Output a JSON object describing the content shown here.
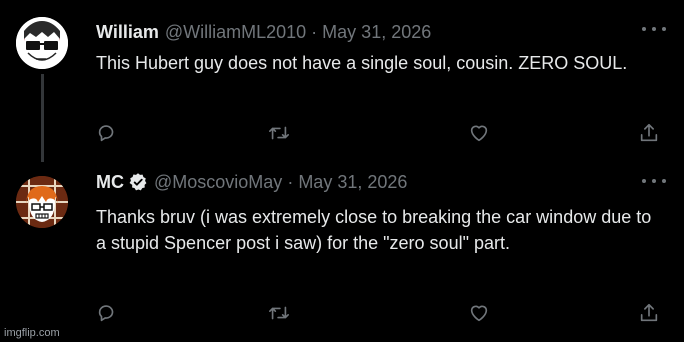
{
  "tweets": [
    {
      "name": "William",
      "handle": "@WilliamML2010",
      "separator": "·",
      "date": "May 31, 2026",
      "text": "This Hubert guy does not have a single soul, cousin. ZERO SOUL.",
      "verified": false
    },
    {
      "name": "MC",
      "handle": "@MoscovioMay",
      "separator": "·",
      "date": "May 31, 2026",
      "text": "Thanks bruv (i was extremely close to breaking the car window due to a stupid Spencer post i saw) for the \"zero soul\" part.",
      "verified": true
    }
  ],
  "icons": {
    "reply": "reply-icon",
    "retweet": "retweet-icon",
    "like": "heart-icon",
    "share": "share-icon",
    "more": "more-icon",
    "verified": "verified-badge-icon"
  },
  "colors": {
    "background": "#000000",
    "text": "#e7e9ea",
    "muted": "#71767b"
  },
  "watermark": "imgflip.com"
}
